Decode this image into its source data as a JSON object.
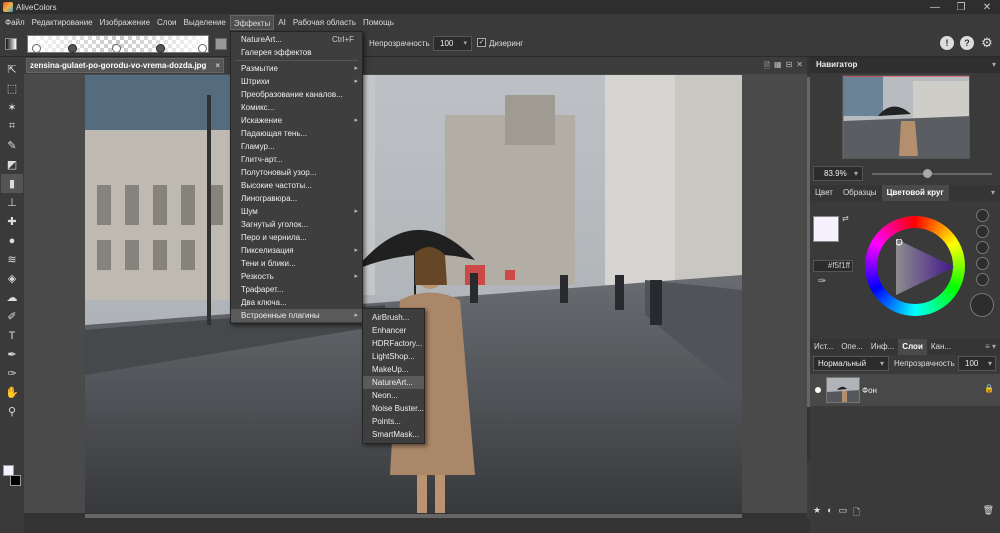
{
  "app": {
    "title": "AliveColors"
  },
  "window": {
    "minimize": "—",
    "maximize": "❐",
    "close": "✕"
  },
  "menubar": [
    "Файл",
    "Редактирование",
    "Изображение",
    "Слои",
    "Выделение",
    "Эффекты",
    "AI",
    "Рабочая область",
    "Помощь"
  ],
  "options": {
    "opacity_label": "Непрозрачность",
    "opacity_value": "100",
    "dither_label": "Дизеринг",
    "dither_checked": "✓",
    "icons": [
      "!",
      "?",
      "⚙"
    ]
  },
  "tools": [
    "select-arrow-icon",
    "lasso-icon",
    "magic-wand-icon",
    "crop-icon",
    "brush-icon",
    "eraser-icon",
    "gradient-icon",
    "stamp-icon",
    "healing-icon",
    "drop-icon",
    "smudge-icon",
    "fill-icon",
    "sponge-icon",
    "pen-icon",
    "text-icon",
    "path-icon",
    "eyedropper-icon",
    "hand-icon",
    "zoom-icon"
  ],
  "tool_glyphs": [
    "⇱",
    "⬚",
    "✶",
    "⌗",
    "✎",
    "◩",
    "▮",
    "⊥",
    "✚",
    "●",
    "≋",
    "◈",
    "☁",
    "✐",
    "T",
    "✒",
    "✑",
    "✋",
    "⚲"
  ],
  "document": {
    "tab_name": "zensina-gulaet-po-gorodu-vo-vrema-dozda.jpg",
    "tab_close": "×",
    "tab_icons": [
      "🗎",
      "▦",
      "⊟",
      "✕"
    ]
  },
  "effects_menu": {
    "items": [
      {
        "label": "NatureArt...",
        "shortcut": "Ctrl+F"
      },
      {
        "label": "Галерея эффектов"
      },
      {
        "sep": true
      },
      {
        "label": "Размытие",
        "sub": true
      },
      {
        "label": "Штрихи",
        "sub": true
      },
      {
        "label": "Преобразование каналов..."
      },
      {
        "label": "Комикс..."
      },
      {
        "label": "Искажение",
        "sub": true
      },
      {
        "label": "Падающая тень..."
      },
      {
        "label": "Гламур..."
      },
      {
        "label": "Глитч-арт..."
      },
      {
        "label": "Полутоновый узор..."
      },
      {
        "label": "Высокие частоты..."
      },
      {
        "label": "Линогравюра..."
      },
      {
        "label": "Шум",
        "sub": true
      },
      {
        "label": "Загнутый уголок..."
      },
      {
        "label": "Перо и чернила..."
      },
      {
        "label": "Пикселизация",
        "sub": true
      },
      {
        "label": "Тени и блики..."
      },
      {
        "label": "Резкость",
        "sub": true
      },
      {
        "label": "Трафарет..."
      },
      {
        "label": "Два ключа..."
      },
      {
        "label": "Встроенные плагины",
        "sub": true,
        "highlight": true
      }
    ],
    "submenu_arrow": "▸"
  },
  "plugins_menu": {
    "items": [
      "AirBrush...",
      "Enhancer",
      "HDRFactory...",
      "LightShop...",
      "MakeUp...",
      "NatureArt...",
      "Neon...",
      "Noise Buster...",
      "Points...",
      "SmartMask..."
    ],
    "highlight_index": 5
  },
  "navigator": {
    "title": "Навигатор",
    "zoom": "83.9%",
    "zoom_fraction": 0.46
  },
  "color_panel": {
    "tabs": [
      "Цвет",
      "Образцы",
      "Цветовой круг"
    ],
    "active_tab": 2,
    "hex": "#f5f1ff",
    "fg_color": "#f5f1ff",
    "bg_color": "#000000"
  },
  "layers_panel": {
    "tabs": [
      "Ист...",
      "Опе...",
      "Инф...",
      "Слои",
      "Кан..."
    ],
    "active_tab": 3,
    "blend_mode": "Нормальный",
    "opacity_label": "Непрозрачность",
    "opacity_value": "100",
    "layer_name": "Фон",
    "lock_icon": "🔒",
    "bottom_icons": [
      "★",
      "◐",
      "▭",
      "🗋",
      "🗑"
    ]
  },
  "colors": {
    "accent_highlight": "#5a5a5a",
    "panel": "#3a3a3a",
    "menu": "#3e3e3e"
  }
}
